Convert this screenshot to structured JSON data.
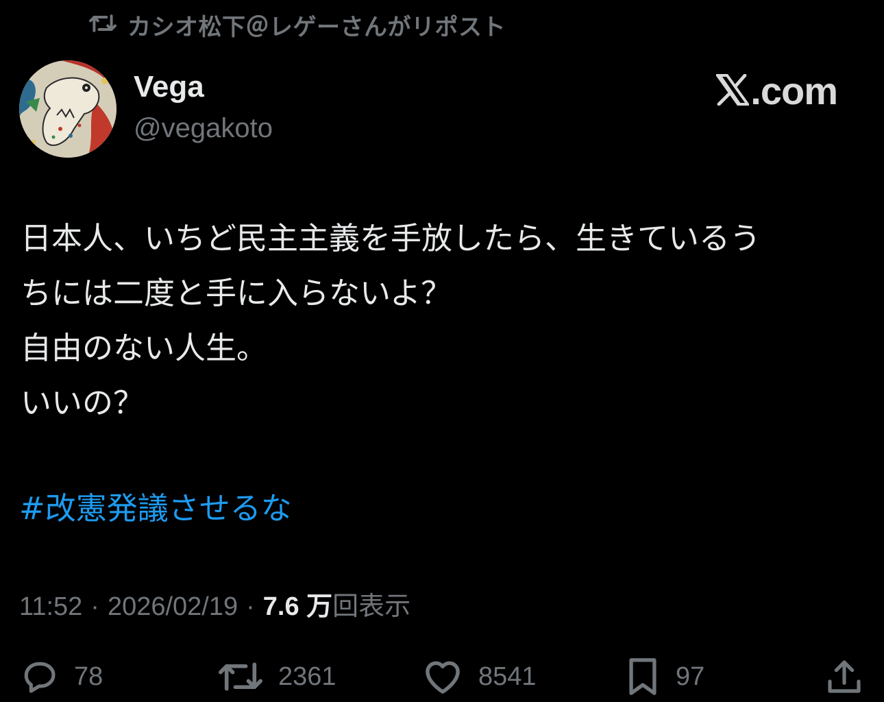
{
  "repost_banner": {
    "icon": "repost-icon",
    "text": "カシオ松下＠レゲーさんがリポスト"
  },
  "author": {
    "display_name": "Vega",
    "handle": "@vegakoto",
    "avatar": "avatar-illustration"
  },
  "brand": {
    "logo": "x-logo-icon",
    "text": ".com"
  },
  "tweet": {
    "lines": [
      "日本人、いちど民主主義を手放したら、生きているう",
      "ちには二度と手に入らないよ？",
      "自由のない人生。",
      "いいの？"
    ],
    "hashtag": "#改憲発議させるな"
  },
  "meta": {
    "time": "11:52",
    "separator": "·",
    "date": "2026/02/19",
    "views_number": "7.6 万",
    "views_label": "回表示"
  },
  "actions": {
    "reply": {
      "icon": "reply-icon",
      "count": "78"
    },
    "repost": {
      "icon": "repost-icon",
      "count": "2361"
    },
    "like": {
      "icon": "heart-icon",
      "count": "8541"
    },
    "bookmark": {
      "icon": "bookmark-icon",
      "count": "97"
    },
    "share": {
      "icon": "share-icon"
    }
  },
  "colors": {
    "background": "#000000",
    "text": "#e7e9ea",
    "secondary": "#71767b",
    "accent": "#1d9bf0"
  }
}
